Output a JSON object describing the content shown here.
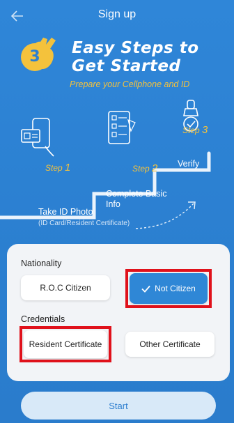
{
  "header": {
    "title": "Sign up",
    "back_icon": "arrow-left-icon"
  },
  "banner": {
    "badge_number": "3",
    "headline_line1": "Easy Steps to",
    "headline_line2": "Get Started",
    "subtitle": "Prepare your Cellphone and ID"
  },
  "steps": [
    {
      "step_word": "Step",
      "step_num": "1",
      "title": "Take ID Photo",
      "note": "(ID Card/Resident Certificate)",
      "icon": "phone-id-icon"
    },
    {
      "step_word": "Step",
      "step_num": "2",
      "title": "Complete Basic Info",
      "icon": "form-checklist-icon"
    },
    {
      "step_word": "Step",
      "step_num": "3",
      "title": "Verify",
      "icon": "stamp-icon"
    }
  ],
  "form": {
    "nationality_label": "Nationality",
    "nationality_options": [
      "R.O.C Citizen",
      "Not Citizen"
    ],
    "nationality_selected": "Not Citizen",
    "credentials_label": "Credentials",
    "credential_options": [
      "Resident Certificate",
      "Other Certificate"
    ]
  },
  "start_label": "Start",
  "colors": {
    "background": "#2b7fd0",
    "accent_yellow": "#f4c23c",
    "selected_blue": "#2f87d6",
    "highlight_red": "#e0111b"
  }
}
